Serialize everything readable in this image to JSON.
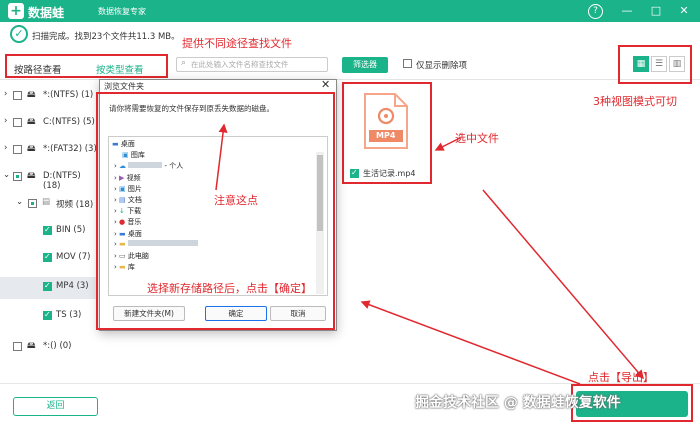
{
  "app": {
    "logo_glyph": "+",
    "name": "数据蛙",
    "subtitle": "数据恢复专家",
    "accent": "#1bb38a",
    "win_buttons": [
      "?",
      "—",
      "□",
      "✕"
    ]
  },
  "status": {
    "icon": "check-circle-icon",
    "text": "扫描完成。找到23个文件共11.3 MB。"
  },
  "tabs": [
    "按路径查看",
    "按类型查看"
  ],
  "search": {
    "placeholder": "在此处输入文件名称查找文件"
  },
  "filter_label": "筛选器",
  "deleted_only_label": "仅显示删除项",
  "view_modes": [
    "grid-icon",
    "list-icon",
    "detail-icon"
  ],
  "tree": [
    {
      "label": "*:(NTFS) (1)"
    },
    {
      "label": "C:(NTFS) (5)"
    },
    {
      "label": "*:(FAT32) (3)"
    },
    {
      "label": "D:(NTFS) (18)"
    },
    {
      "label": "视频 (18)"
    },
    {
      "label": "BIN (5)"
    },
    {
      "label": "MOV (7)"
    },
    {
      "label": "MP4 (3)"
    },
    {
      "label": "TS (3)"
    },
    {
      "label": "*:() (0)"
    }
  ],
  "file": {
    "ext": "MP4",
    "name": "生活记录.mp4"
  },
  "dialog": {
    "title": "浏览文件夹",
    "close": "✕",
    "message": "请你将需要恢复的文件保存到原丢失数据的磁盘。",
    "items": [
      "桌面",
      "图库",
      "- 个人",
      "视频",
      "图片",
      "文档",
      "下载",
      "音乐",
      "桌面",
      "",
      "此电脑",
      "库"
    ],
    "new_folder": "新建文件夹(M)",
    "ok": "确定",
    "cancel": "取消"
  },
  "back_label": "返回",
  "annotations": {
    "a1": "提供不同途径查找文件",
    "a2": "3种视图模式可切",
    "a3": "选中文件",
    "a4": "注意这点",
    "a5": "选择新存储路径后，点击【确定】",
    "a6": "点击【导出】"
  },
  "watermark": "掘金技术社区 @ 数据蛙恢复软件"
}
